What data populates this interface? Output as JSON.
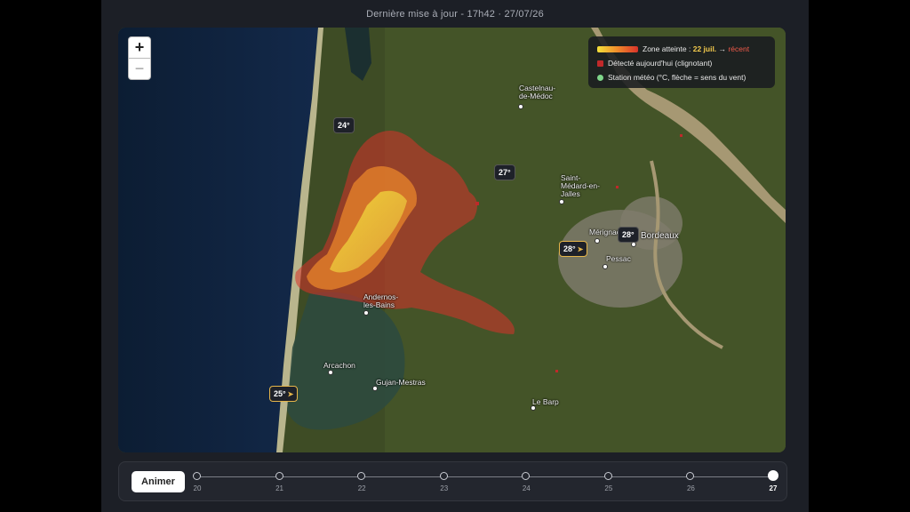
{
  "header": {
    "update_text": "Dernière mise à jour - 17h42 · 27/07/26"
  },
  "map": {
    "zoom_in": "+",
    "zoom_out": "−",
    "places": [
      "Castelnau-de-Médoc",
      "Saint-Médard-en-Jalles",
      "Mérignac",
      "Bordeaux",
      "Pessac",
      "Andernos-les-Bains",
      "Arcachon",
      "Gujan-Mestras",
      "Le Barp"
    ],
    "stations": [
      {
        "temp": "24°",
        "wind": false
      },
      {
        "temp": "27°",
        "wind": false
      },
      {
        "temp": "28°",
        "wind": false
      },
      {
        "temp": "28°",
        "wind": true
      },
      {
        "temp": "25°",
        "wind": true
      }
    ],
    "colors": {
      "burn_old": "#f4e13a",
      "burn_mid": "#f08a2b",
      "burn_recent": "#d8322a",
      "detected_today": "#c0292a",
      "weather_station": "#7fd68a",
      "wind_accent": "#e6b64a"
    }
  },
  "legend": {
    "burn_label": "Zone atteinte :",
    "burn_date": "22 juil.",
    "arrow": "→",
    "recent": "récent",
    "detected": "Détecté aujourd'hui (clignotant)",
    "station": "Station météo (°C, flèche = sens du vent)"
  },
  "timeline": {
    "button": "Animer",
    "days": [
      "20",
      "21",
      "22",
      "23",
      "24",
      "25",
      "26",
      "27"
    ],
    "selected": "27"
  }
}
